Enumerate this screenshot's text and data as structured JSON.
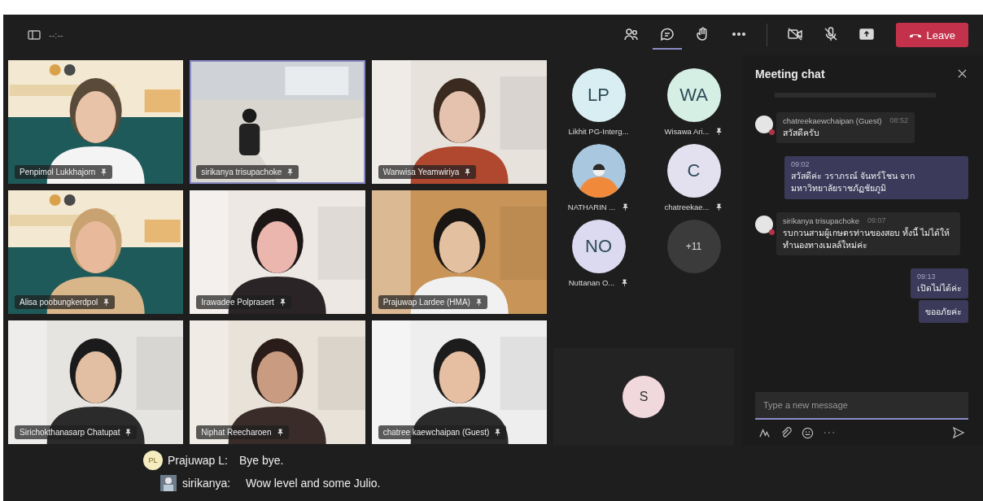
{
  "toolbar": {
    "timer": "--:--",
    "buttons": [
      {
        "kind": "people",
        "selected": false
      },
      {
        "kind": "chat",
        "selected": true
      },
      {
        "kind": "hand",
        "selected": false
      },
      {
        "kind": "more",
        "selected": false
      },
      {
        "kind": "camera",
        "selected": false
      },
      {
        "kind": "mic",
        "selected": false
      },
      {
        "kind": "share",
        "selected": false
      }
    ],
    "leave": "Leave"
  },
  "videos": [
    {
      "name": "Penpimol Lukkhajorn",
      "speaking": false
    },
    {
      "name": "sirikanya trisupachoke",
      "speaking": true
    },
    {
      "name": "Wanwisa Yeamwiriya",
      "speaking": false
    },
    {
      "name": "Alisa poobungkerdpol",
      "speaking": false
    },
    {
      "name": "Irawadee Polprasert",
      "speaking": false
    },
    {
      "name": "Prajuwap Lardee (HMA)",
      "speaking": false
    },
    {
      "name": "Sirichokthanasarp Chatupat",
      "speaking": false
    },
    {
      "name": "Niphat Reecharoen",
      "speaking": false
    },
    {
      "name": "chatree kaewchaipan (Guest)",
      "speaking": false
    }
  ],
  "avatars": [
    {
      "kind": "initials",
      "initials": "LP",
      "name": "Likhit PG-Interg...",
      "pinned": false,
      "color": "#d9eef2"
    },
    {
      "kind": "initials",
      "initials": "WA",
      "name": "Wisawa Ari...",
      "pinned": true,
      "color": "#d6efe4"
    },
    {
      "name": "NATHARIN ...",
      "pinned": true
    },
    {
      "kind": "initials",
      "initials": "C",
      "name": "chatreekae...",
      "pinned": true,
      "color": "#e3e0f0"
    },
    {
      "kind": "initials",
      "initials": "NO",
      "name": "Nuttanan O...",
      "pinned": true,
      "color": "#dcdaf0"
    },
    {
      "kind": "overflow",
      "initials": "+11"
    }
  ],
  "spotlight": {
    "initials": "S"
  },
  "chat": {
    "title": "Meeting chat",
    "messages": [
      {
        "kind": "received",
        "sender": "chatreekaewchaipan (Guest)",
        "time": "08:52",
        "texts": [
          "สวัสดีครับ"
        ]
      },
      {
        "kind": "sent",
        "time": "09:02",
        "texts": [
          "สวัสดีค่ะ วราภรณ์ จันทร์โชน จาก มหาวิทยาลัยราชภัฏชัยภูมิ"
        ]
      },
      {
        "kind": "received",
        "sender": "sirikanya trisupachoke",
        "time": "09:07",
        "texts": [
          "รบกวนสามผู้เกษตรท่านของสอบ ทั้งนี้ ไม่ได้ให้ทำนองทางเมลล์ใหม่ค่ะ"
        ]
      },
      {
        "kind": "sent",
        "time": "09:13",
        "texts": [
          "เปิดไม่ได้ค่ะ",
          "ขออภัยค่ะ"
        ]
      }
    ],
    "compose": {
      "placeholder": "Type a new message"
    }
  },
  "captions": [
    {
      "kind": "initials",
      "initials": "PL",
      "speaker": "Prajuwap L:",
      "text": "Bye bye."
    },
    {
      "speaker": "sirikanya:",
      "text": "Wow level and some Julio."
    }
  ]
}
